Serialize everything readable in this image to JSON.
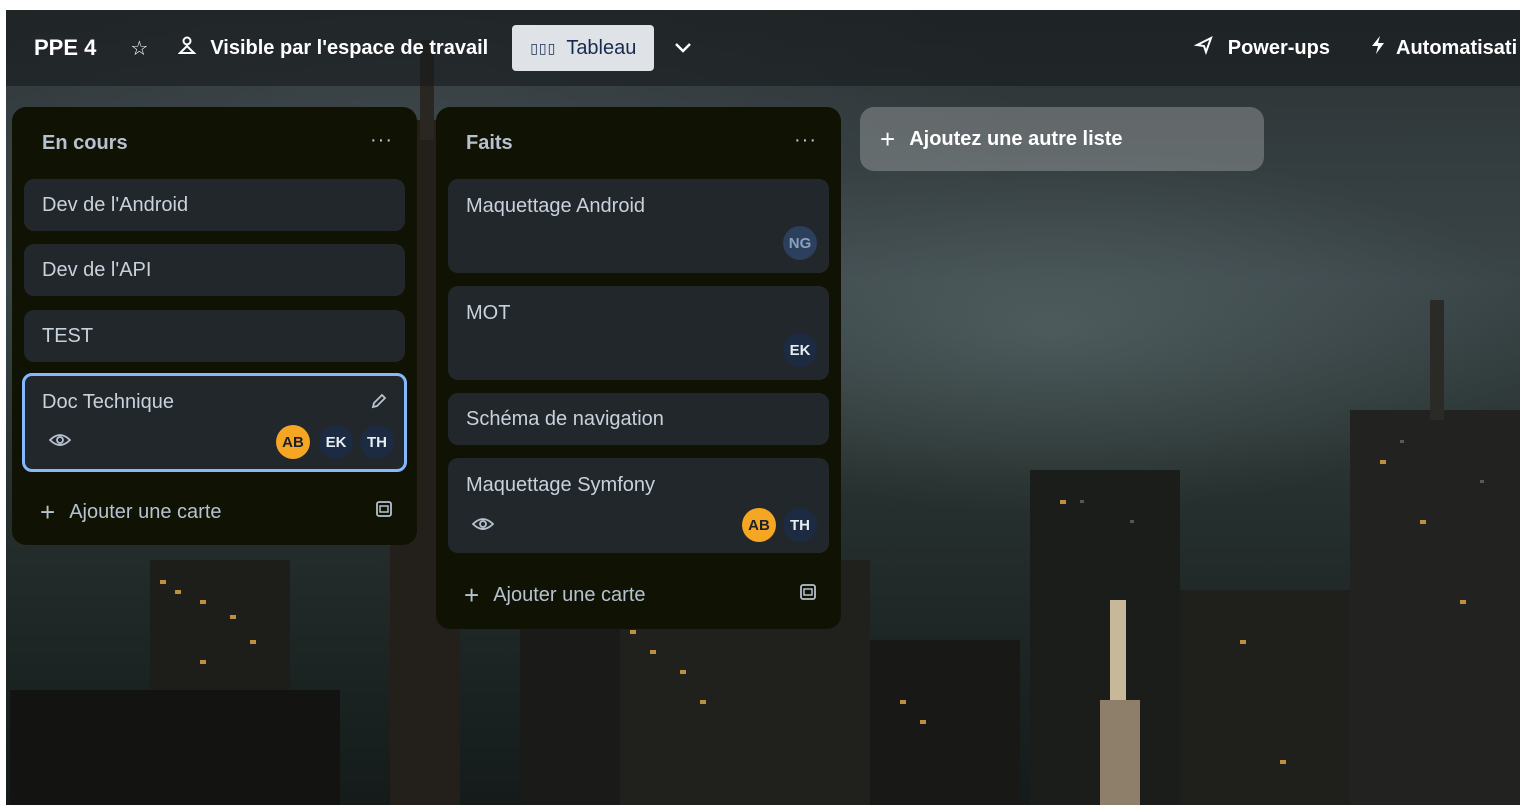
{
  "board": {
    "title": "PPE 4",
    "visibility_label": "Visible par l'espace de travail",
    "view_label": "Tableau",
    "powerups_label": "Power-ups",
    "automation_label": "Automatisati"
  },
  "lists": [
    {
      "title": "En cours",
      "menu": "···",
      "cards": [
        {
          "text": "Dev de l'Android"
        },
        {
          "text": "Dev de l'API"
        },
        {
          "text": "TEST"
        },
        {
          "text": "Doc Technique",
          "watching": true,
          "members": [
            "AB",
            "EK",
            "TH"
          ]
        }
      ],
      "add_card_label": "Ajouter une carte"
    },
    {
      "title": "Faits",
      "menu": "···",
      "cards": [
        {
          "text": "Maquettage Android",
          "members": [
            "NG"
          ]
        },
        {
          "text": "MOT",
          "members": [
            "EK"
          ]
        },
        {
          "text": "Schéma de navigation"
        },
        {
          "text": "Maquettage Symfony",
          "watching": true,
          "members": [
            "AB",
            "TH"
          ]
        }
      ],
      "add_card_label": "Ajouter une carte"
    }
  ],
  "add_list_label": "Ajoutez une autre liste",
  "colors": {
    "list_bg": "#101204",
    "card_bg": "#22272b",
    "selected_border": "#85b8ff",
    "avatar_orange": "#f5a623",
    "avatar_navy": "#1c2b41"
  },
  "icons": {
    "star": "star-icon",
    "visibility": "people-icon",
    "view": "board-icon",
    "chevron": "chevron-down-icon",
    "powerups": "rocket-icon",
    "automation": "lightning-icon",
    "menu": "more-icon",
    "watch": "eye-icon",
    "edit": "pencil-icon",
    "template": "card-template-icon",
    "add": "plus-icon"
  }
}
